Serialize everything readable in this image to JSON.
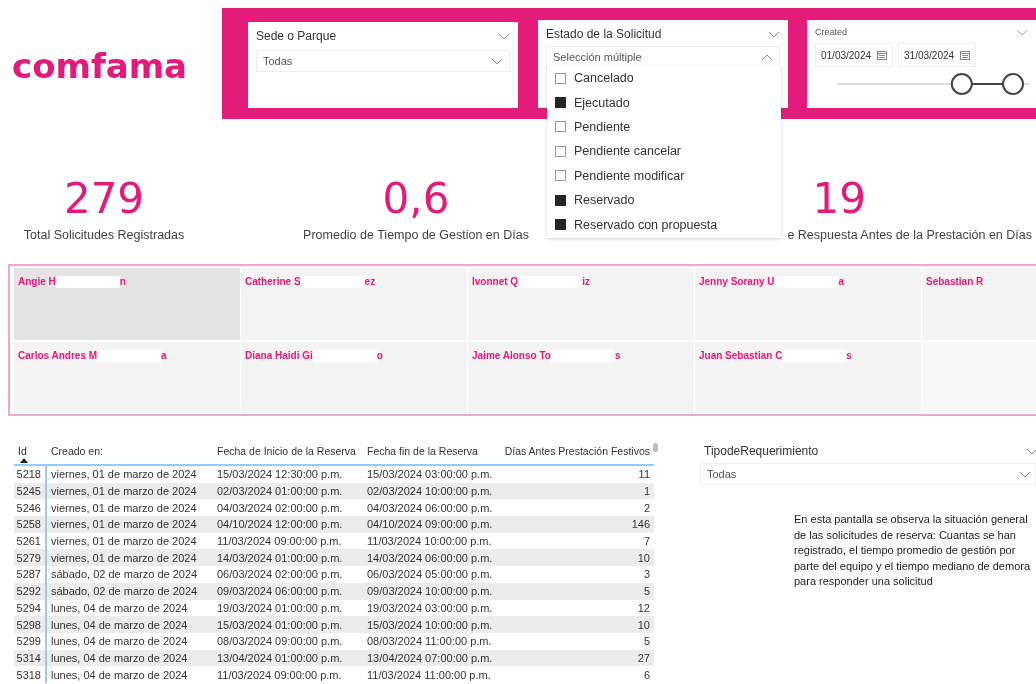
{
  "logo": {
    "text": "comfama"
  },
  "filters": [
    {
      "kind": "dropdown",
      "title": "Sede o Parque",
      "value": "Todas"
    },
    {
      "kind": "multiselect",
      "title": "Estado de la Solicitud",
      "value": "Selección múltiple",
      "expanded": true,
      "options": [
        {
          "label": "Cancelado",
          "checked": false
        },
        {
          "label": "Ejecutado",
          "checked": true
        },
        {
          "label": "Pendiente",
          "checked": false
        },
        {
          "label": "Pendiente cancelar",
          "checked": false
        },
        {
          "label": "Pendiente modificar",
          "checked": false
        },
        {
          "label": "Reservado",
          "checked": true
        },
        {
          "label": "Reservado con propuesta",
          "checked": true
        }
      ]
    },
    {
      "kind": "date_range",
      "title": "Created",
      "start": "01/03/2024",
      "end": "31/03/2024",
      "level": 0.65
    }
  ],
  "kpis": [
    {
      "value": "279",
      "label": "Total Solicitudes Registradas"
    },
    {
      "value": "0,6",
      "label": "Promedio de Tiempo de Gestion en Días"
    },
    {
      "value": "19",
      "label": "e Respuesta Antes de la Prestación en Días"
    }
  ],
  "people": [
    {
      "name_start": "Angie H",
      "name_end": "n",
      "selected": true
    },
    {
      "name_start": "Catherine S",
      "name_end": "ez",
      "selected": false
    },
    {
      "name_start": "Ivonnet Q",
      "name_end": "iz",
      "selected": false
    },
    {
      "name_start": "Jenny Sorany U",
      "name_end": "a",
      "selected": false
    },
    {
      "name_start": "Sebastian R",
      "selected": false
    },
    {
      "name_start": "Carlos Andres M",
      "name_end": "a",
      "selected": false
    },
    {
      "name_start": "Diana Haidi Gi",
      "name_end": "o",
      "selected": false
    },
    {
      "name_start": "Jaime Alonso To",
      "name_end": "s",
      "selected": false
    },
    {
      "name_start": "Juan Sebastian C",
      "name_end": "s",
      "selected": false
    }
  ],
  "table": {
    "columns": [
      {
        "label": "Id",
        "sorted": true
      },
      {
        "label": "Creado en:",
        "sorted": false
      },
      {
        "label": "Fecha de Inicio de la Reserva",
        "sorted": false
      },
      {
        "label": "Fecha fin de la Reserva",
        "sorted": false
      },
      {
        "label": "Días Antes Prestación Festivos",
        "sorted": false
      }
    ],
    "rows": [
      [
        "5218",
        "viernes, 01 de marzo de 2024",
        "15/03/2024 12:30:00 p.m.",
        "15/03/2024 03:00:00 p.m.",
        "11"
      ],
      [
        "5245",
        "viernes, 01 de marzo de 2024",
        "02/03/2024 01:00:00 p.m.",
        "02/03/2024 10:00:00 p.m.",
        "1"
      ],
      [
        "5246",
        "viernes, 01 de marzo de 2024",
        "04/03/2024 02:00:00 p.m.",
        "04/03/2024 06:00:00 p.m.",
        "2"
      ],
      [
        "5258",
        "viernes, 01 de marzo de 2024",
        "04/10/2024 12:00:00 p.m.",
        "04/10/2024 09:00:00 p.m.",
        "146"
      ],
      [
        "5261",
        "viernes, 01 de marzo de 2024",
        "11/03/2024 09:00:00 p.m.",
        "11/03/2024 10:00:00 p.m.",
        "7"
      ],
      [
        "5279",
        "viernes, 01 de marzo de 2024",
        "14/03/2024 01:00:00 p.m.",
        "14/03/2024 06:00:00 p.m.",
        "10"
      ],
      [
        "5287",
        "sábado, 02 de marzo de 2024",
        "06/03/2024 02:00:00 p.m.",
        "06/03/2024 05:00:00 p.m.",
        "3"
      ],
      [
        "5292",
        "sábado, 02 de marzo de 2024",
        "09/03/2024 06:00:00 p.m.",
        "09/03/2024 10:00:00 p.m.",
        "5"
      ],
      [
        "5294",
        "lunes, 04 de marzo de 2024",
        "19/03/2024 01:00:00 p.m.",
        "19/03/2024 03:00:00 p.m.",
        "12"
      ],
      [
        "5298",
        "lunes, 04 de marzo de 2024",
        "15/03/2024 01:00:00 p.m.",
        "15/03/2024 10:00:00 p.m.",
        "10"
      ],
      [
        "5299",
        "lunes, 04 de marzo de 2024",
        "08/03/2024 09:00:00 p.m.",
        "08/03/2024 11:00:00 p.m.",
        "5"
      ],
      [
        "5314",
        "lunes, 04 de marzo de 2024",
        "13/04/2024 01:00:00 p.m.",
        "13/04/2024 07:00:00 p.m.",
        "27"
      ],
      [
        "5318",
        "lunes, 04 de marzo de 2024",
        "11/03/2024 09:00:00 p.m.",
        "11/03/2024 11:00:00 p.m.",
        "6"
      ]
    ]
  },
  "type_filter": {
    "title": "TipodeRequerimiento",
    "value": "Todas"
  },
  "description": "En esta pantalla se observa la situación general de las solicitudes de reserva: Cuantas se han registrado, el tiempo promedio de gestión por parte del equipo y el tiempo mediano de demora para responder una solicitud"
}
